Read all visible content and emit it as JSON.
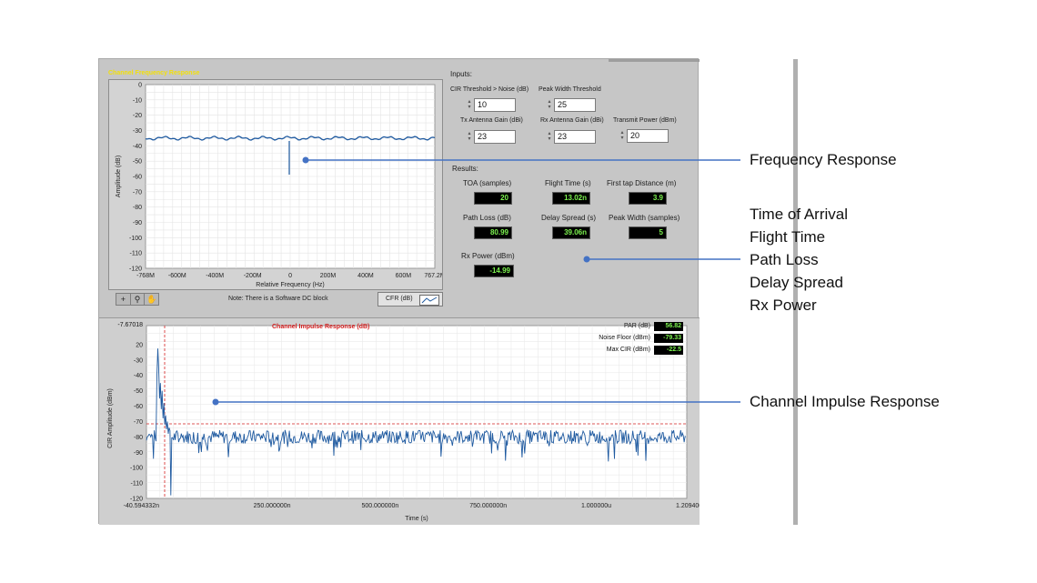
{
  "cfr": {
    "title": "Channel Frequency Response",
    "ylabel": "Amplitude (dB)",
    "xlabel": "Relative Frequency (Hz)",
    "yticks": [
      "0",
      "-10",
      "-20",
      "-30",
      "-40",
      "-50",
      "-60",
      "-70",
      "-80",
      "-90",
      "-100",
      "-110",
      "-120"
    ],
    "xticks": [
      "-768M",
      "-600M",
      "-400M",
      "-200M",
      "0",
      "200M",
      "400M",
      "600M",
      "767.2M"
    ],
    "note": "Note: There is a Software DC block",
    "legend": "CFR (dB)",
    "tools": [
      "+",
      "⚲",
      "✋"
    ]
  },
  "inputs": {
    "heading": "Inputs:",
    "cir_threshold": {
      "label": "CIR Threshold > Noise (dB)",
      "value": "10"
    },
    "peak_width": {
      "label": "Peak Width Threshold",
      "value": "25"
    },
    "tx_gain": {
      "label": "Tx Antenna Gain (dBi)",
      "value": "23"
    },
    "rx_gain": {
      "label": "Rx Antenna Gain (dBi)",
      "value": "23"
    },
    "tx_power": {
      "label": "Transmit Power (dBm)",
      "value": "20"
    }
  },
  "results": {
    "heading": "Results:",
    "toa": {
      "label": "TOA (samples)",
      "value": "20"
    },
    "flight_time": {
      "label": "Flight Time (s)",
      "value": "13.02n"
    },
    "first_tap": {
      "label": "First tap Distance (m)",
      "value": "3.9"
    },
    "path_loss": {
      "label": "Path Loss (dB)",
      "value": "80.99"
    },
    "delay_spread": {
      "label": "Delay Spread (s)",
      "value": "39.06n"
    },
    "peak_width": {
      "label": "Peak Width (samples)",
      "value": "5"
    },
    "rx_power": {
      "label": "Rx Power (dBm)",
      "value": "-14.99"
    }
  },
  "cir": {
    "title": "Channel Impulse Response (dB)",
    "ylabel": "CIR Amplitude (dBm)",
    "xlabel": "Time (s)",
    "ytop": "-7.67018",
    "yticks": [
      "20",
      "-30",
      "-40",
      "-50",
      "-60",
      "-70",
      "-80",
      "-90",
      "-100",
      "-110",
      "-120"
    ],
    "xticks": [
      "-40.594332n",
      "250.000000n",
      "500.000000n",
      "750.000000n",
      "1.000000u",
      "1.209406u"
    ],
    "stats": [
      {
        "label": "PAR (dB)",
        "value": "56.82"
      },
      {
        "label": "Noise Floor (dBm)",
        "value": "-79.33"
      },
      {
        "label": "Max CIR (dBm)",
        "value": "-22.5"
      }
    ]
  },
  "annotations": {
    "frequency": "Frequency Response",
    "results": [
      "Time of Arrival",
      "Flight Time",
      "Path Loss",
      "Delay Spread",
      "Rx Power"
    ],
    "impulse": "Channel Impulse Response"
  },
  "colors": {
    "trace": "#1f5aa0",
    "callout": "#4472c4",
    "indicator_text": "#7cf34f",
    "cir_title": "#d42020"
  }
}
